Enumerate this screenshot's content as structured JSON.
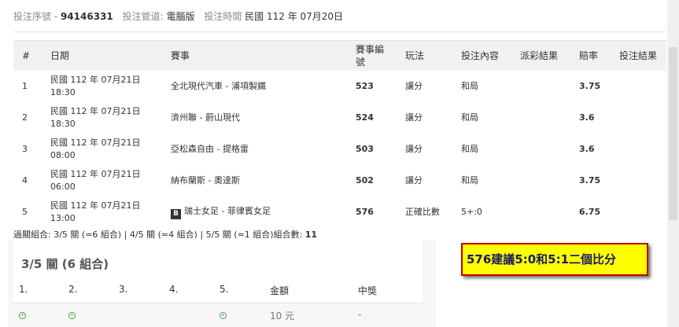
{
  "info": {
    "serial_label": "投注序號 -",
    "serial_value": "94146331",
    "channel_label": "投注管道:",
    "channel_value": "電腦版",
    "time_label": "投注時間",
    "time_value": "民國 112 年 07月20日"
  },
  "table": {
    "headers": [
      "#",
      "日期",
      "賽事",
      "賽事編號",
      "玩法",
      "投注內容",
      "派彩結果",
      "賠率",
      "投注結果"
    ],
    "rows": [
      {
        "num": "1",
        "date1": "民國 112 年 07月21日",
        "date2": "18:30",
        "match": "全北現代汽車 - 浦項製鐵",
        "code": "523",
        "play": "讓分",
        "bet": "和局",
        "result": "",
        "odds": "3.75",
        "outcome": ""
      },
      {
        "num": "2",
        "date1": "民國 112 年 07月21日",
        "date2": "18:30",
        "match": "濟州聯 - 蔚山現代",
        "code": "524",
        "play": "讓分",
        "bet": "和局",
        "result": "",
        "odds": "3.6",
        "outcome": ""
      },
      {
        "num": "3",
        "date1": "民國 112 年 07月21日",
        "date2": "08:00",
        "match": "亞松森自由 - 提格雷",
        "code": "503",
        "play": "讓分",
        "bet": "和局",
        "result": "",
        "odds": "3.6",
        "outcome": ""
      },
      {
        "num": "4",
        "date1": "民國 112 年 07月21日",
        "date2": "06:00",
        "match": "納布蘭斯 - 奧達斯",
        "code": "502",
        "play": "讓分",
        "bet": "和局",
        "result": "",
        "odds": "3.75",
        "outcome": ""
      },
      {
        "num": "5",
        "date1": "民國 112 年 07月21日",
        "date2": "13:00",
        "badge": "B",
        "match": "瑞士女足 - 菲律賓女足",
        "code": "576",
        "play": "正確比數",
        "bet": "5+:0",
        "result": "",
        "odds": "6.75",
        "outcome": ""
      }
    ]
  },
  "summary": {
    "text": "過關組合: 3/5 關 (=6 組合) | 4/5 關 (=4 組合) | 5/5 關 (=1 組合)組合數:",
    "count": "11"
  },
  "sub": {
    "title": "3/5 關 (6 組合)",
    "headers": [
      "1.",
      "2.",
      "3.",
      "4.",
      "5.",
      "金額",
      "中獎"
    ],
    "amount": "10 元",
    "win": "-"
  },
  "note": "576建議5:0和5:1二個比分",
  "colors": {
    "note_bg": "#ffff00",
    "note_border": "#c00000",
    "clock": "#4a9b4a"
  }
}
